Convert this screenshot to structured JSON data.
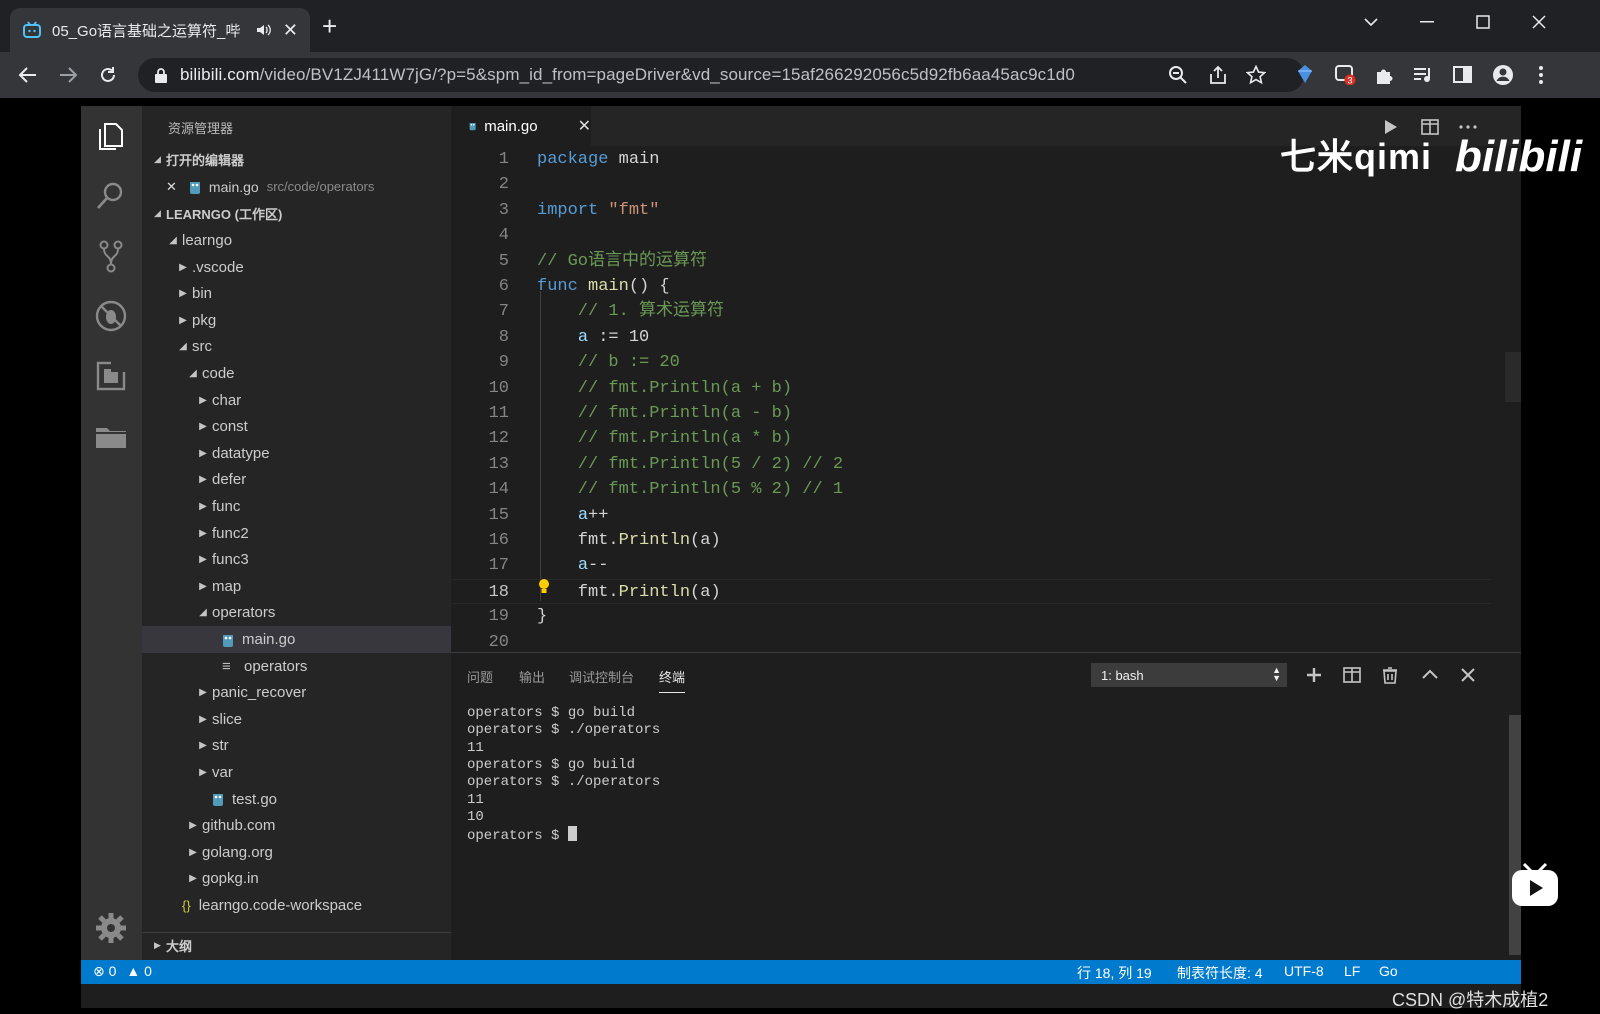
{
  "browser": {
    "tab_title": "05_Go语言基础之运算符_哔",
    "url_host": "bilibili.com",
    "url_path": "/video/BV1ZJ411W7jG/?p=5&spm_id_from=pageDriver&vd_source=15af266292056c5d92fb6aa45ac9c1d0",
    "extension_badge": "3"
  },
  "vscode": {
    "sidebar_title": "资源管理器",
    "open_editors_label": "打开的编辑器",
    "open_editor_file": "main.go",
    "open_editor_path": "src/code/operators",
    "workspace_label": "LEARNGO (工作区)",
    "tree": [
      {
        "label": "learngo",
        "depth": 0,
        "kind": "open"
      },
      {
        "label": ".vscode",
        "depth": 1,
        "kind": "closed"
      },
      {
        "label": "bin",
        "depth": 1,
        "kind": "closed"
      },
      {
        "label": "pkg",
        "depth": 1,
        "kind": "closed"
      },
      {
        "label": "src",
        "depth": 1,
        "kind": "open"
      },
      {
        "label": "code",
        "depth": 2,
        "kind": "open"
      },
      {
        "label": "char",
        "depth": 3,
        "kind": "closed"
      },
      {
        "label": "const",
        "depth": 3,
        "kind": "closed"
      },
      {
        "label": "datatype",
        "depth": 3,
        "kind": "closed"
      },
      {
        "label": "defer",
        "depth": 3,
        "kind": "closed"
      },
      {
        "label": "func",
        "depth": 3,
        "kind": "closed"
      },
      {
        "label": "func2",
        "depth": 3,
        "kind": "closed"
      },
      {
        "label": "func3",
        "depth": 3,
        "kind": "closed"
      },
      {
        "label": "map",
        "depth": 3,
        "kind": "closed"
      },
      {
        "label": "operators",
        "depth": 3,
        "kind": "open"
      },
      {
        "label": "main.go",
        "depth": 4,
        "kind": "gofile",
        "selected": true
      },
      {
        "label": "operators",
        "depth": 4,
        "kind": "binary"
      },
      {
        "label": "panic_recover",
        "depth": 3,
        "kind": "closed"
      },
      {
        "label": "slice",
        "depth": 3,
        "kind": "closed"
      },
      {
        "label": "str",
        "depth": 3,
        "kind": "closed"
      },
      {
        "label": "var",
        "depth": 3,
        "kind": "closed"
      },
      {
        "label": "test.go",
        "depth": 3,
        "kind": "gofile"
      },
      {
        "label": "github.com",
        "depth": 2,
        "kind": "closed"
      },
      {
        "label": "golang.org",
        "depth": 2,
        "kind": "closed"
      },
      {
        "label": "gopkg.in",
        "depth": 2,
        "kind": "closed"
      },
      {
        "label": "learngo.code-workspace",
        "depth": 1,
        "kind": "json"
      }
    ],
    "outline_label": "大纲",
    "editor_tab": "main.go",
    "code": [
      {
        "n": "1",
        "text": "package main"
      },
      {
        "n": "2",
        "text": ""
      },
      {
        "n": "3",
        "text": "import \"fmt\""
      },
      {
        "n": "4",
        "text": ""
      },
      {
        "n": "5",
        "text": "// Go语言中的运算符"
      },
      {
        "n": "6",
        "text": "func main() {"
      },
      {
        "n": "7",
        "text": "    // 1. 算术运算符"
      },
      {
        "n": "8",
        "text": "    a := 10"
      },
      {
        "n": "9",
        "text": "    // b := 20"
      },
      {
        "n": "10",
        "text": "    // fmt.Println(a + b)"
      },
      {
        "n": "11",
        "text": "    // fmt.Println(a - b)"
      },
      {
        "n": "12",
        "text": "    // fmt.Println(a * b)"
      },
      {
        "n": "13",
        "text": "    // fmt.Println(5 / 2) // 2"
      },
      {
        "n": "14",
        "text": "    // fmt.Println(5 % 2) // 1"
      },
      {
        "n": "15",
        "text": "    a++"
      },
      {
        "n": "16",
        "text": "    fmt.Println(a)"
      },
      {
        "n": "17",
        "text": "    a--"
      },
      {
        "n": "18",
        "text": "    fmt.Println(a)"
      },
      {
        "n": "19",
        "text": "}"
      },
      {
        "n": "20",
        "text": ""
      }
    ],
    "panel_tabs": [
      "问题",
      "输出",
      "调试控制台",
      "终端"
    ],
    "terminal_select": "1: bash",
    "terminal_lines": [
      "operators $ go build",
      "operators $ ./operators",
      "11",
      "operators $ go build",
      "operators $ ./operators",
      "11",
      "10",
      "operators $ "
    ],
    "status": {
      "errors": "0",
      "warnings": "0",
      "position": "行 18, 列 19",
      "tab_size": "制表符长度: 4",
      "encoding": "UTF-8",
      "eol": "LF",
      "language": "Go"
    }
  },
  "overlay": {
    "watermark": "七米qimi",
    "site_logo": "bilibili",
    "csdn": "CSDN @特木成植2"
  }
}
